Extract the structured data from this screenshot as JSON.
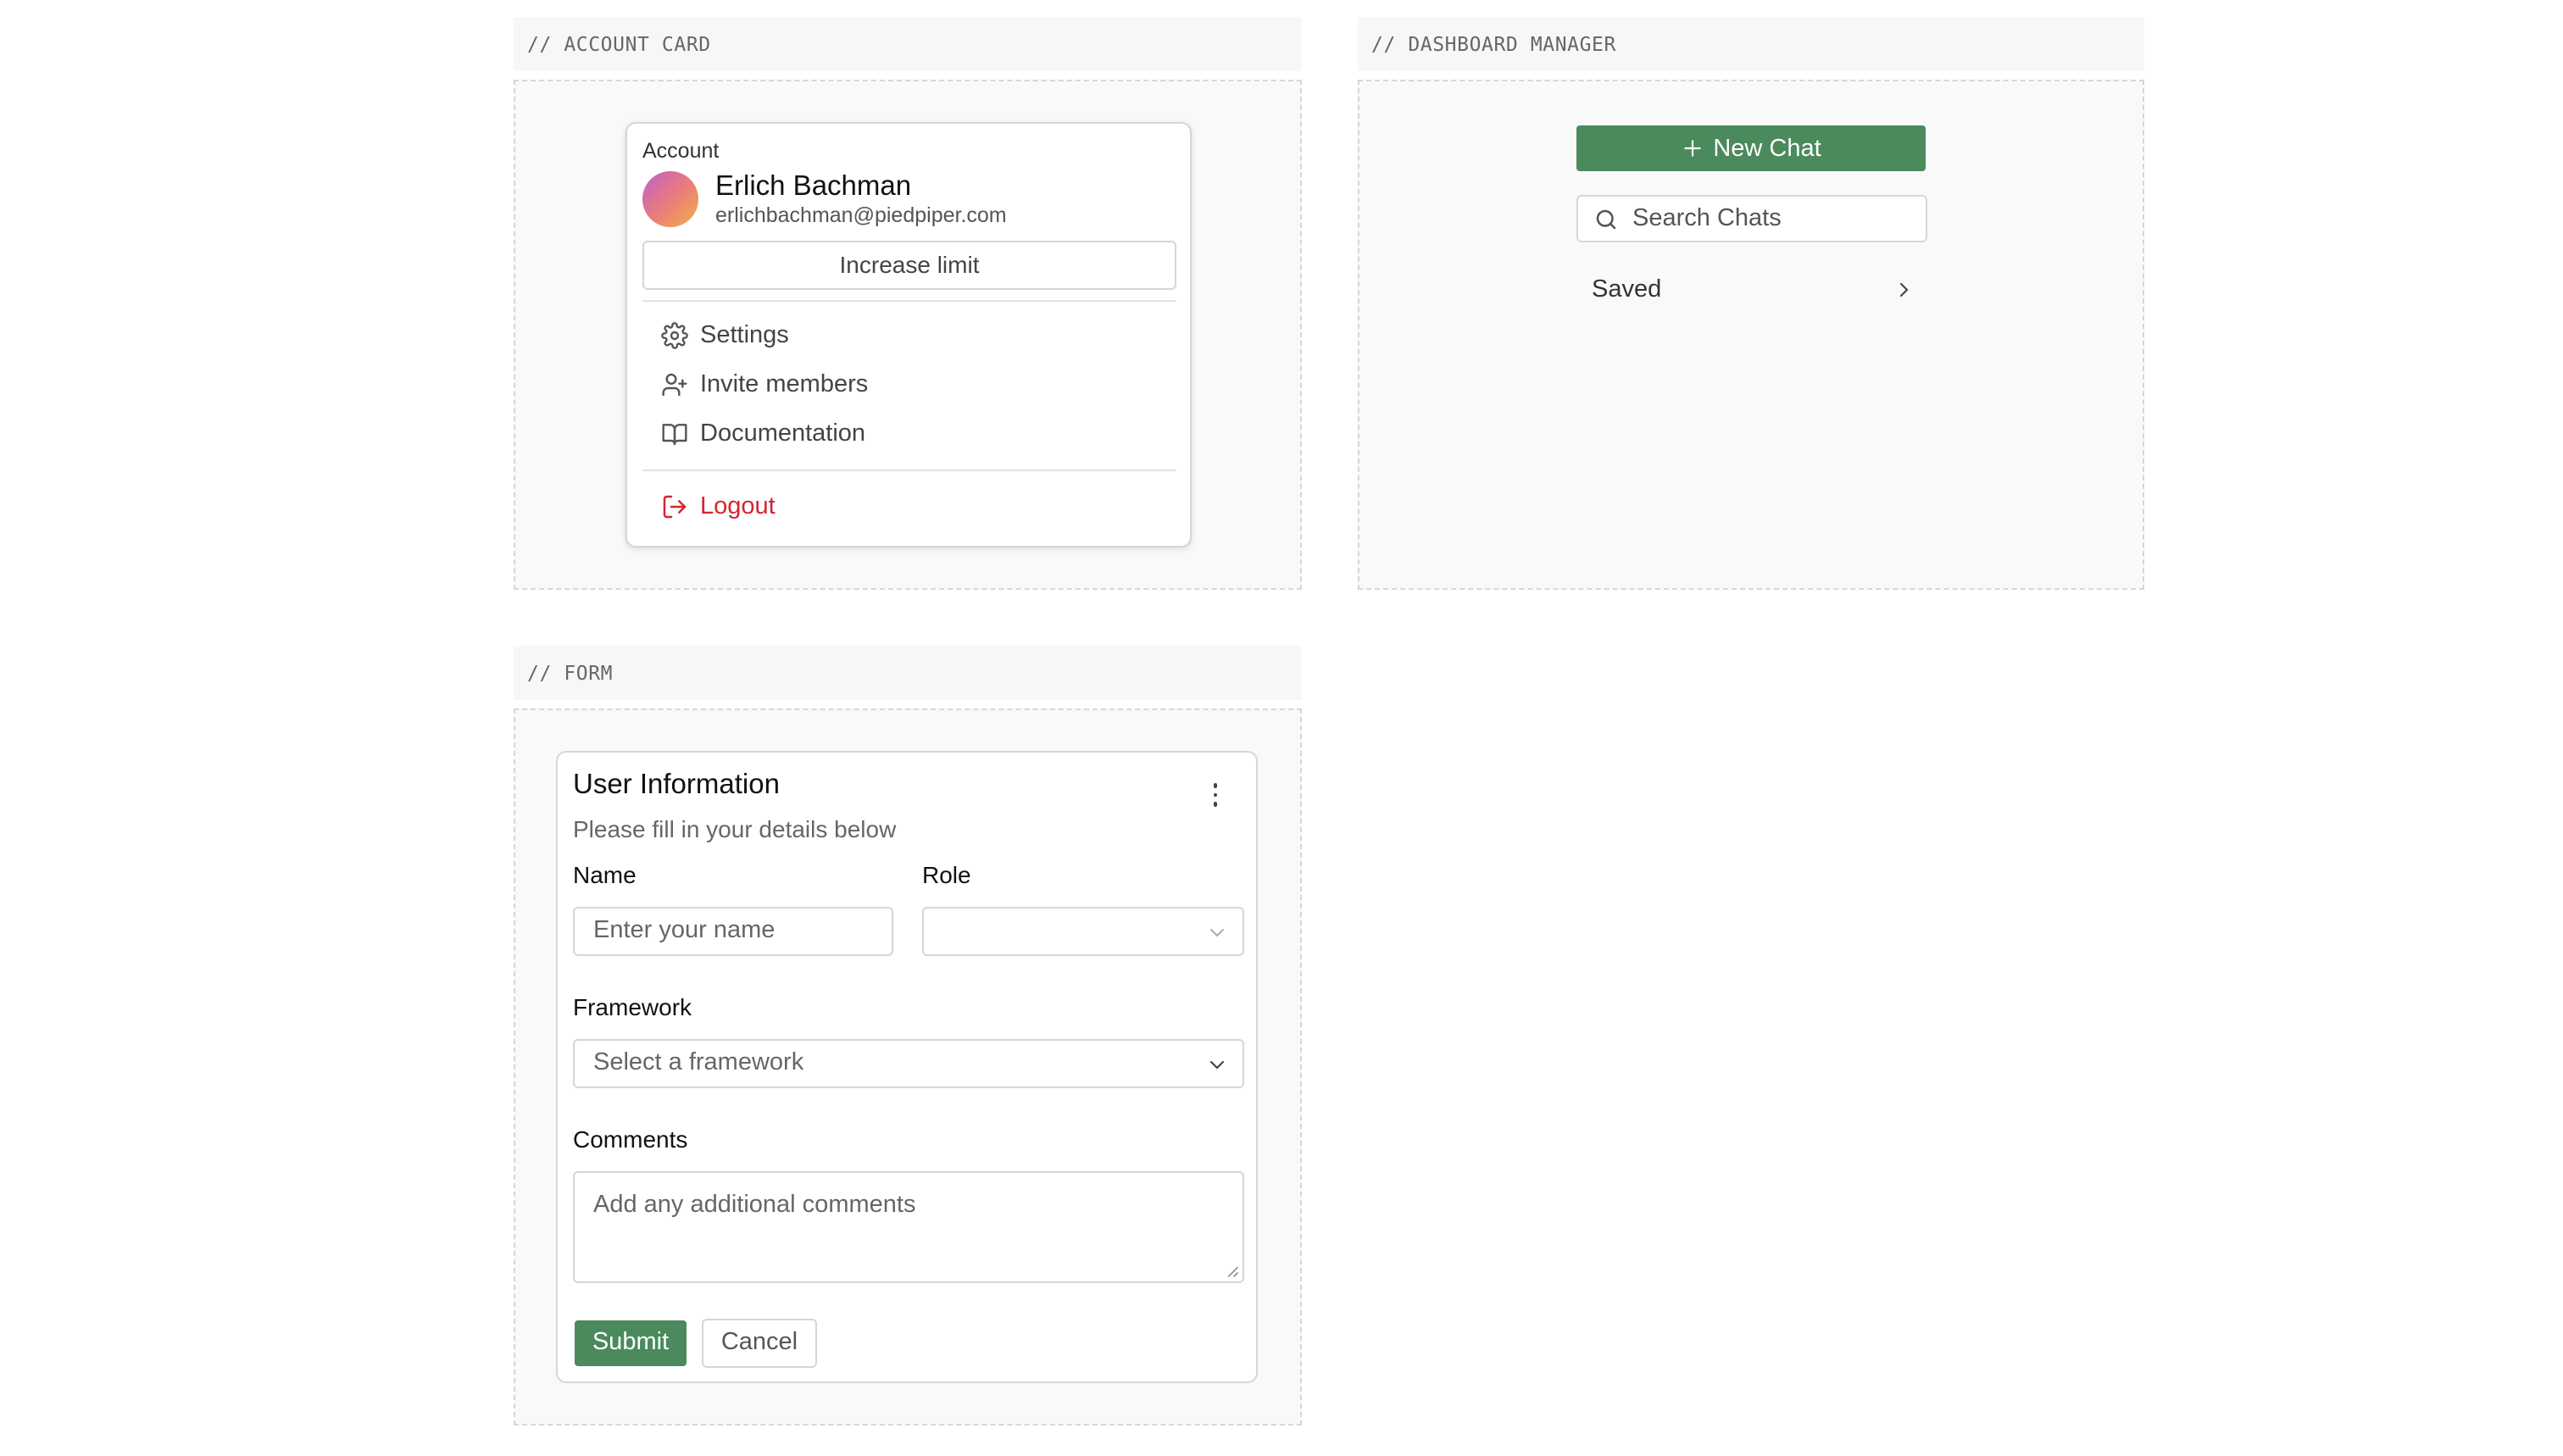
{
  "sections": {
    "account_card_label": "// ACCOUNT CARD",
    "dashboard_label": "// DASHBOARD MANAGER",
    "form_label": "// FORM"
  },
  "account": {
    "heading": "Account",
    "name": "Erlich Bachman",
    "email": "erlichbachman@piedpiper.com",
    "increase_limit": "Increase limit",
    "menu": [
      {
        "label": "Settings",
        "icon": "gear-icon"
      },
      {
        "label": "Invite members",
        "icon": "user-plus-icon"
      },
      {
        "label": "Documentation",
        "icon": "book-icon"
      }
    ],
    "logout": {
      "label": "Logout",
      "icon": "logout-icon"
    },
    "colors": {
      "logout": "#d4242f"
    }
  },
  "dashboard": {
    "new_chat": "New Chat",
    "search_placeholder": "Search Chats",
    "saved": "Saved",
    "colors": {
      "accent": "#4a8a5c"
    }
  },
  "form": {
    "title": "User Information",
    "subtitle": "Please fill in your details below",
    "name_label": "Name",
    "name_placeholder": "Enter your name",
    "role_label": "Role",
    "role_value": "",
    "framework_label": "Framework",
    "framework_placeholder": "Select a framework",
    "comments_label": "Comments",
    "comments_placeholder": "Add any additional comments",
    "submit": "Submit",
    "cancel": "Cancel"
  }
}
